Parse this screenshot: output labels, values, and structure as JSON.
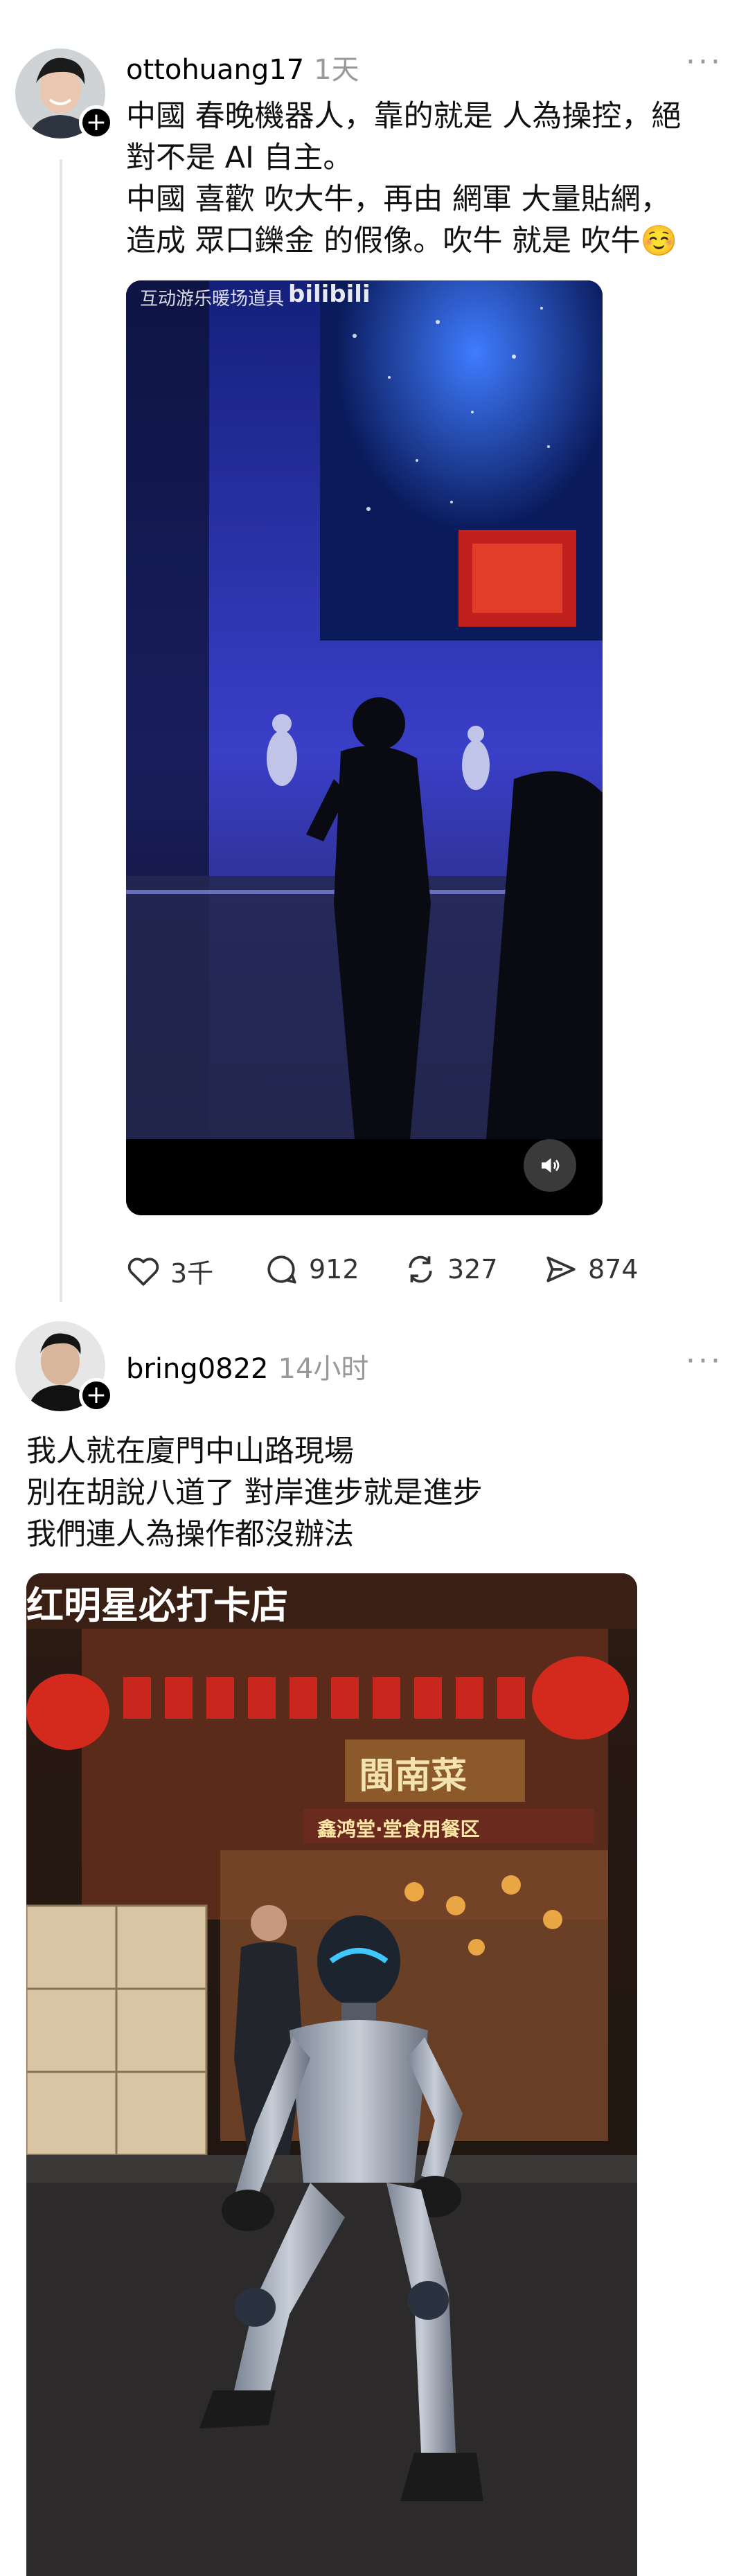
{
  "posts": [
    {
      "username": "ottohuang17",
      "time": "1天",
      "more": "···",
      "text": "中國 春晚機器人，靠的就是 人為操控，絕\n對不是 AI 自主。\n中國 喜歡 吹大牛，再由 網軍 大量貼網，\n造成 眾口鑠金 的假像。吹牛 就是 吹牛☺️",
      "video_overlay": "互动游乐暖场道具",
      "video_brand": "bilibili",
      "stats": {
        "likes": "3千",
        "comments": "912",
        "reposts": "327",
        "shares": "874"
      }
    },
    {
      "username": "bring0822",
      "time": "14小时",
      "more": "···",
      "text": "我人就在廈門中山路現場\n別在胡說八道了 對岸進步就是進步\n我們連人為操作都沒辦法",
      "image_signs": {
        "top": "红明星必打卡店",
        "board": "閩南菜",
        "sub": "鑫鸿堂·堂食用餐区"
      }
    }
  ],
  "icons": [
    "plus-icon",
    "heart-icon",
    "comment-icon",
    "repost-icon",
    "share-icon",
    "sound-icon"
  ]
}
